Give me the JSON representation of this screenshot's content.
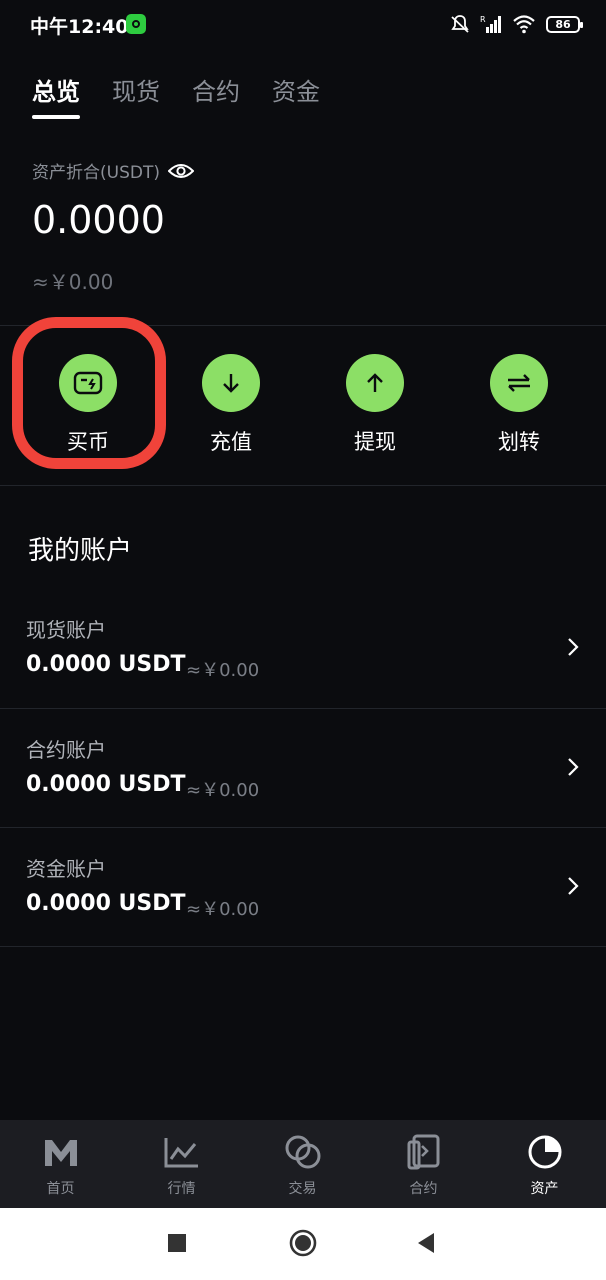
{
  "status_bar": {
    "time": "中午12:40",
    "battery": "86"
  },
  "tabs": [
    {
      "label": "总览",
      "active": true
    },
    {
      "label": "现货",
      "active": false
    },
    {
      "label": "合约",
      "active": false
    },
    {
      "label": "资金",
      "active": false
    }
  ],
  "overview": {
    "label": "资产折合(USDT)",
    "value": "0.0000",
    "fiat": "≈￥0.00"
  },
  "actions": [
    {
      "label": "买币",
      "icon": "buy-card-icon",
      "highlighted": true
    },
    {
      "label": "充值",
      "icon": "arrow-down-icon"
    },
    {
      "label": "提现",
      "icon": "arrow-up-icon"
    },
    {
      "label": "划转",
      "icon": "transfer-arrows-icon"
    }
  ],
  "accounts_section": {
    "title": "我的账户",
    "items": [
      {
        "name": "现货账户",
        "amount": "0.0000 USDT",
        "fiat": "≈￥0.00"
      },
      {
        "name": "合约账户",
        "amount": "0.0000 USDT",
        "fiat": "≈￥0.00"
      },
      {
        "name": "资金账户",
        "amount": "0.0000 USDT",
        "fiat": "≈￥0.00"
      }
    ]
  },
  "bottom_nav": [
    {
      "label": "首页",
      "icon": "m-logo-icon"
    },
    {
      "label": "行情",
      "icon": "chart-line-icon"
    },
    {
      "label": "交易",
      "icon": "exchange-circles-icon"
    },
    {
      "label": "合约",
      "icon": "contract-document-icon"
    },
    {
      "label": "资产",
      "icon": "pie-chart-icon",
      "active": true
    }
  ],
  "colors": {
    "accent": "#8cdf66",
    "highlight": "#f0433a",
    "background": "#0b0c0f"
  }
}
